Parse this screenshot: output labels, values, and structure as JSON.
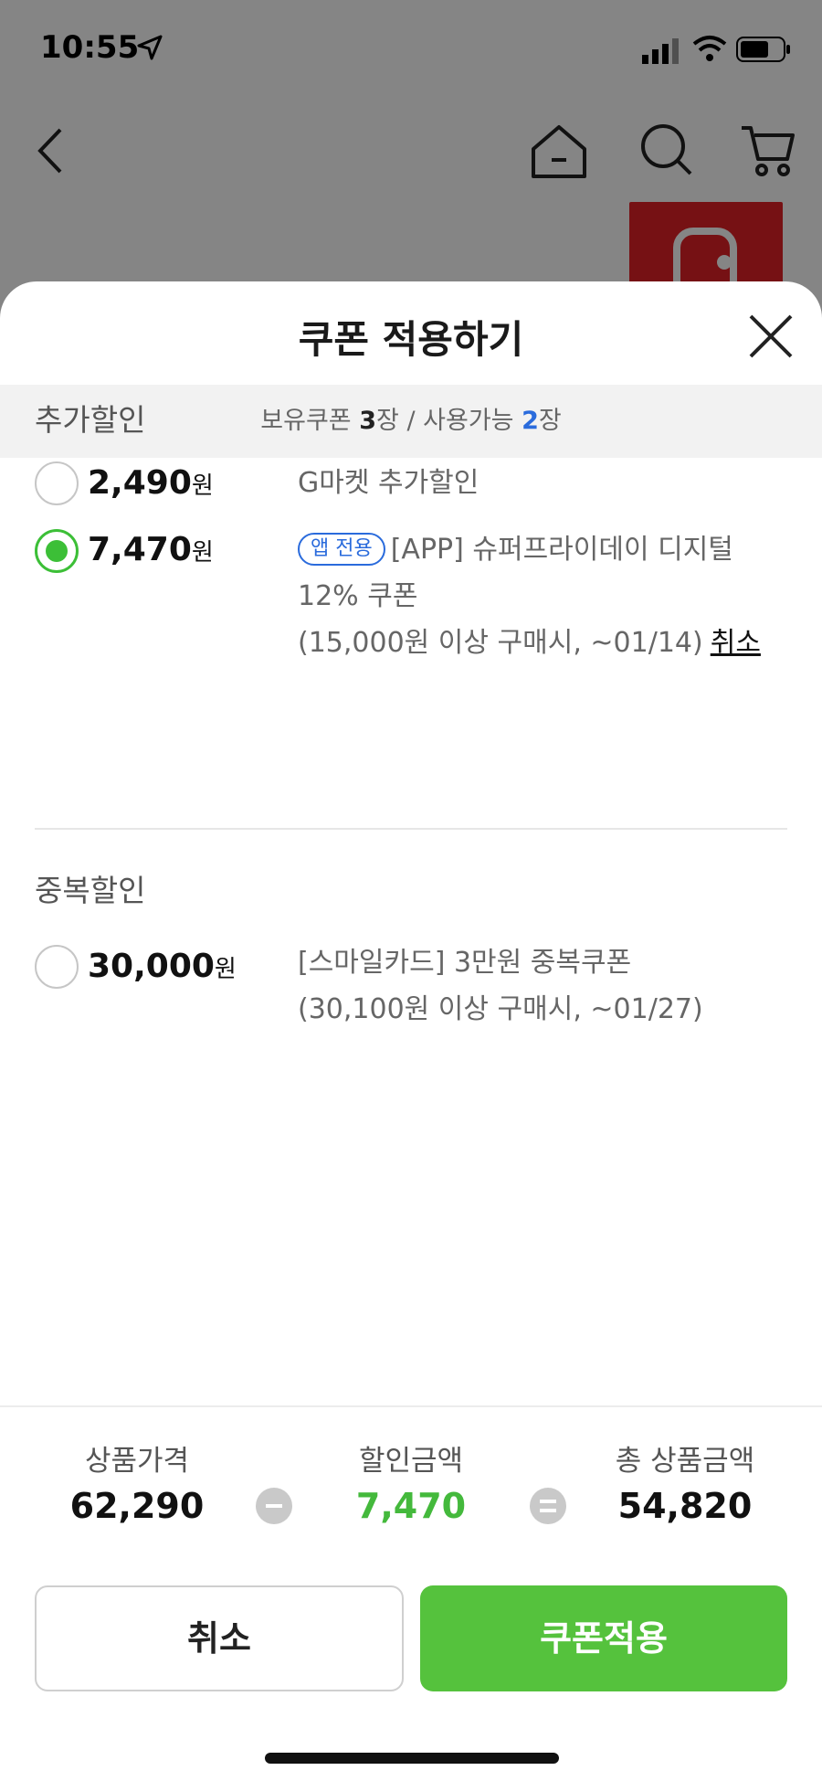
{
  "status_bar": {
    "time": "10:55"
  },
  "sheet": {
    "title": "쿠폰 적용하기",
    "summary": {
      "held_label": "보유쿠폰 ",
      "held_count": "3",
      "held_unit": "장 / 사용가능 ",
      "usable_count": "2",
      "usable_unit": "장"
    }
  },
  "sections": [
    {
      "heading": "추가할인",
      "coupons": [
        {
          "amount": "2,490",
          "unit": "원",
          "selected": false,
          "name": "G마켓 추가할인"
        },
        {
          "amount": "7,470",
          "unit": "원",
          "selected": true,
          "badge": "앱 전용",
          "name": "[APP] 슈퍼프라이데이 디지털 12% 쿠폰",
          "condition": "(15,000원 이상 구매시, ~01/14)",
          "cancel_label": "취소"
        }
      ]
    },
    {
      "heading": "중복할인",
      "coupons": [
        {
          "amount": "30,000",
          "unit": "원",
          "selected": false,
          "name": "[스마일카드] 3만원 중복쿠폰",
          "condition": "(30,100원 이상 구매시, ~01/27)"
        }
      ]
    }
  ],
  "totals": {
    "product_price_label": "상품가격",
    "product_price": "62,290",
    "discount_label": "할인금액",
    "discount": "7,470",
    "total_label": "총 상품금액",
    "total": "54,820"
  },
  "buttons": {
    "cancel": "취소",
    "apply": "쿠폰적용"
  },
  "colors": {
    "accent_green": "#55c23d",
    "badge_blue": "#2a6bdc"
  }
}
